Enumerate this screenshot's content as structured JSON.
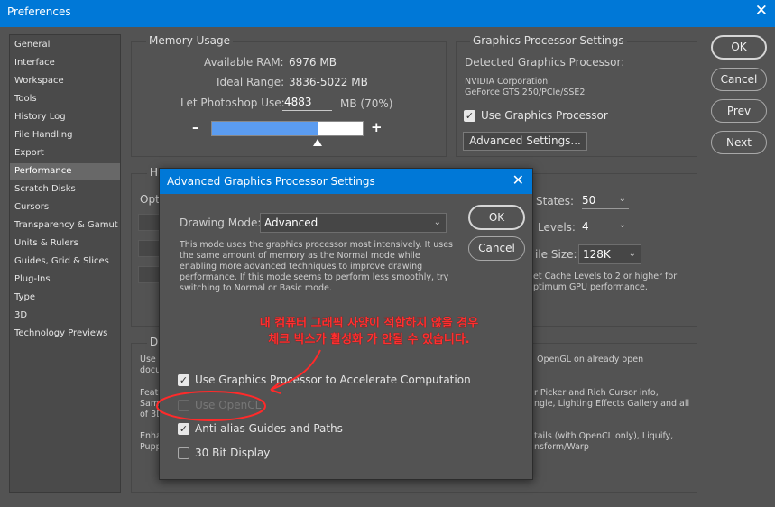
{
  "window": {
    "title": "Preferences",
    "close": "✕"
  },
  "sidebar": {
    "items": [
      {
        "label": "General"
      },
      {
        "label": "Interface"
      },
      {
        "label": "Workspace"
      },
      {
        "label": "Tools"
      },
      {
        "label": "History Log"
      },
      {
        "label": "File Handling"
      },
      {
        "label": "Export"
      },
      {
        "label": "Performance"
      },
      {
        "label": "Scratch Disks"
      },
      {
        "label": "Cursors"
      },
      {
        "label": "Transparency & Gamut"
      },
      {
        "label": "Units & Rulers"
      },
      {
        "label": "Guides, Grid & Slices"
      },
      {
        "label": "Plug-Ins"
      },
      {
        "label": "Type"
      },
      {
        "label": "3D"
      },
      {
        "label": "Technology Previews"
      }
    ],
    "selected_index": 7
  },
  "memory": {
    "title": "Memory Usage",
    "available_label": "Available RAM:",
    "available_value": "6976 MB",
    "ideal_label": "Ideal Range:",
    "ideal_value": "3836-5022 MB",
    "let_label": "Let Photoshop Use:",
    "let_value": "4883",
    "let_unit": "MB (70%)",
    "slider_fraction": 0.7,
    "minus": "–",
    "plus": "+"
  },
  "gpu": {
    "title": "Graphics Processor Settings",
    "detected_label": "Detected Graphics Processor:",
    "vendor": "NVIDIA Corporation",
    "model": "GeForce GTS 250/PCIe/SSE2",
    "use_gpu_label": "Use Graphics Processor",
    "use_gpu_checked": true,
    "advanced_button": "Advanced Settings..."
  },
  "buttons": {
    "ok": "OK",
    "cancel": "Cancel",
    "prev": "Prev",
    "next": "Next"
  },
  "history": {
    "title_partial": "H",
    "opt_partial": "Opt",
    "states_label": "States:",
    "states_value": "50",
    "levels_label": "Levels:",
    "levels_value": "4",
    "tile_label": "ile Size:",
    "tile_value": "128K",
    "note_line1": "et Cache Levels to 2 or higher for",
    "note_line2": "ptimum GPU performance."
  },
  "details": {
    "title_partial": "D",
    "left_lines": [
      "Use",
      "docu",
      "Feat",
      "Samp",
      "of 3D",
      "Enha",
      "Pupp"
    ],
    "right_lines": [
      "OpenGL on already open",
      "r Picker and Rich Cursor info,",
      "ngle, Lighting Effects Gallery and all",
      "tails (with OpenCL only), Liquify,",
      "nsform/Warp"
    ]
  },
  "modal": {
    "title": "Advanced Graphics Processor Settings",
    "close": "✕",
    "drawing_mode_label": "Drawing Mode:",
    "drawing_mode_value": "Advanced",
    "description": [
      "This mode uses the graphics processor most intensively.  It uses",
      "the same amount of memory as the Normal mode while",
      "enabling more advanced techniques to improve drawing",
      "performance.  If this mode seems to perform less smoothly, try",
      "switching to Normal or Basic mode."
    ],
    "ok": "OK",
    "cancel": "Cancel",
    "options": [
      {
        "label": "Use Graphics Processor to Accelerate Computation",
        "checked": true,
        "enabled": true
      },
      {
        "label": "Use OpenCL",
        "checked": false,
        "enabled": false
      },
      {
        "label": "Anti-alias Guides and Paths",
        "checked": true,
        "enabled": true
      },
      {
        "label": "30 Bit Display",
        "checked": false,
        "enabled": true
      }
    ]
  },
  "annotation": {
    "line1": "내 컴퓨터 그래픽 사양이 적합하지 않을 경우",
    "line2": "체크 박스가 활성화 가 안될 수 있습니다.",
    "color": "#ff2a2a"
  },
  "icons": {
    "check": "✓",
    "chevron": "⌄"
  }
}
